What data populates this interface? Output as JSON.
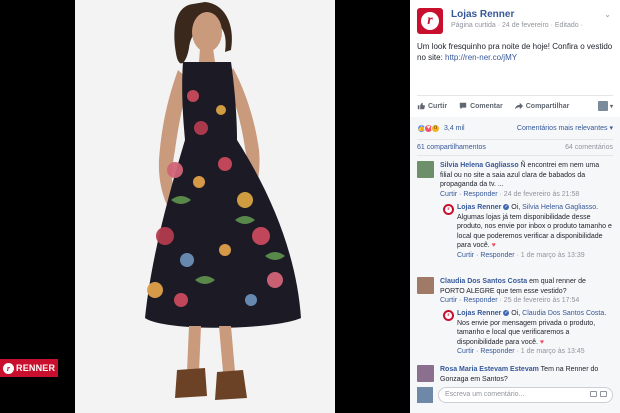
{
  "photo": {
    "brand_badge_text": "RENNER",
    "dress_color": "#1c1a24",
    "skin_color": "#c99a7c",
    "hair_color": "#3a281d",
    "sandal_color": "#6b4226"
  },
  "post": {
    "page_name": "Lojas Renner",
    "meta": "Página curtida · 24 de fevereiro · Editado ·",
    "text": "Um look fresquinho pra noite de hoje! Confira o vestido no site:",
    "link": "http://ren-ner.co/jMY"
  },
  "actions": {
    "like": "Curtir",
    "comment": "Comentar",
    "share": "Compartilhar"
  },
  "reactions": {
    "count": "3,4 mil",
    "relevance": "Comentários mais relevantes ▾",
    "shares": "61 compartilhamentos",
    "comments_count": "64 comentários"
  },
  "comments": [
    {
      "author": "Silvia Helena Gagliasso",
      "text": "Ñ encontrei em nem uma filial ou no site a saia azul clara de babados da propaganda da tv. ...",
      "links": "Curtir · Responder",
      "time": " · 24 de fevereiro às 21:58"
    },
    {
      "author": "Lojas Renner",
      "text_prefix": "Oi,",
      "mention": "Silvia Helena Gagliasso",
      "text": ". Algumas lojas já tem disponibilidade desse produto, nos envie por inbox o produto tamanho e local que poderemos verificar a disponibilidade para você.",
      "links": "Curtir · Responder",
      "time": " · 1 de março às 13:39"
    },
    {
      "author": "Claudia Dos Santos Costa",
      "text": "em qual renner de PORTO ALEGRE que tem esse vestido?",
      "links": "Curtir · Responder",
      "time": " · 25 de fevereiro às 17:54"
    },
    {
      "author": "Lojas Renner",
      "text_prefix": "Oi,",
      "mention": "Claudia Dos Santos Costa",
      "text": ". Nos envie por mensagem privada o produto, tamanho e local que verificaremos a disponibilidade para você.",
      "links": "Curtir · Responder",
      "time": " · 1 de março às 13:45"
    },
    {
      "author": "Rosa Maria Estevam Estevam",
      "text": "Tem na Renner do Gonzaga em Santos?"
    }
  ],
  "write_box": {
    "placeholder": "Escreva um comentário..."
  }
}
